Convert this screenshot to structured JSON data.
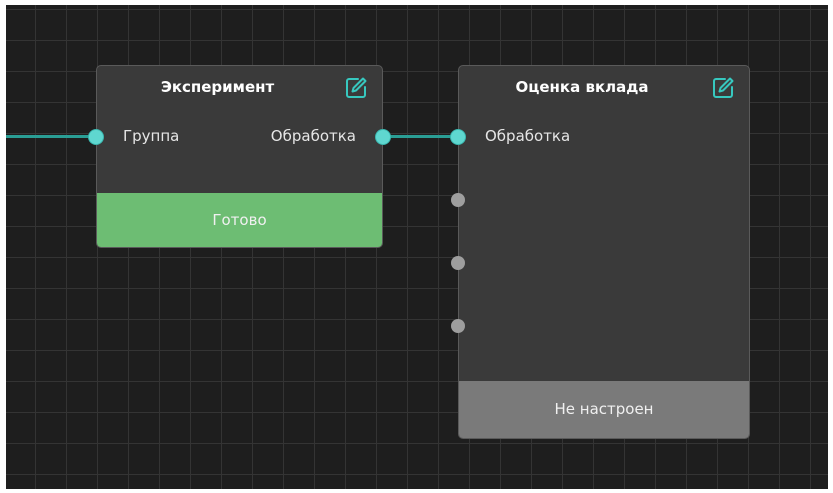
{
  "colors": {
    "canvas_bg": "#1e1e1e",
    "wire": "#2a9e95",
    "port_active": "#5fd7d0",
    "port_idle": "#9e9e9e",
    "status_ready": "#6dbd73",
    "status_not_configured": "#7a7a7a"
  },
  "nodes": [
    {
      "title": "Эксперимент",
      "edit_icon": "pencil-edit-icon",
      "inputs": [
        "Группа"
      ],
      "outputs": [
        "Обработка"
      ],
      "status": "Готово"
    },
    {
      "title": "Оценка вклада",
      "edit_icon": "pencil-edit-icon",
      "inputs": [
        "Обработка",
        "",
        "",
        ""
      ],
      "status": "Не настроен"
    }
  ]
}
